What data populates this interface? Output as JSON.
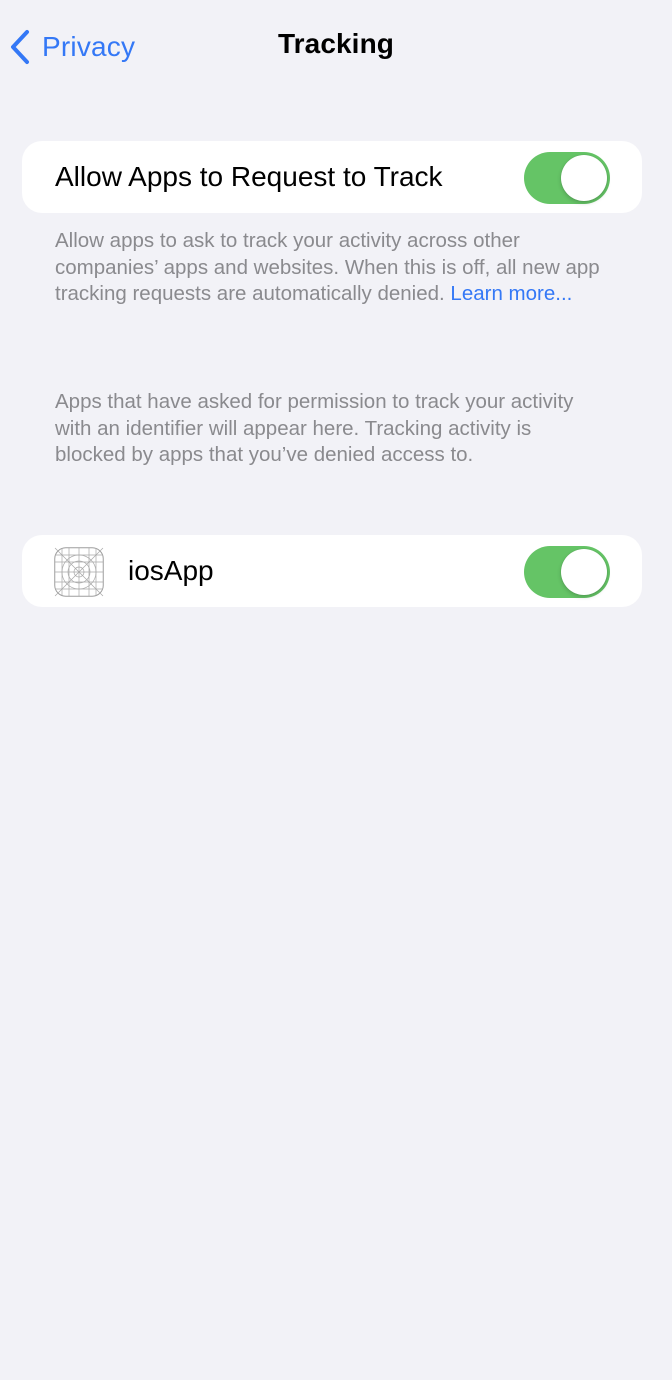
{
  "colors": {
    "accent": "#3478f6",
    "toggle_on": "#65c466",
    "background": "#f2f2f7",
    "secondary_text": "#8a8a8e"
  },
  "nav": {
    "back_label": "Privacy",
    "back_icon": "chevron-left-icon",
    "title": "Tracking"
  },
  "allow_tracking": {
    "label": "Allow Apps to Request to Track",
    "enabled": true
  },
  "allow_footer": {
    "text": "Allow apps to ask to track your activity across other companies’ apps and websites. When this is off, all new app tracking requests are automatically denied.",
    "link": "Learn more..."
  },
  "apps_footer": {
    "text": "Apps that have asked for permission to track your activity with an identifier will appear here. Tracking activity is blocked by apps that you’ve denied access to."
  },
  "apps": [
    {
      "name": "iosApp",
      "icon": "app-placeholder-icon",
      "enabled": true
    }
  ]
}
